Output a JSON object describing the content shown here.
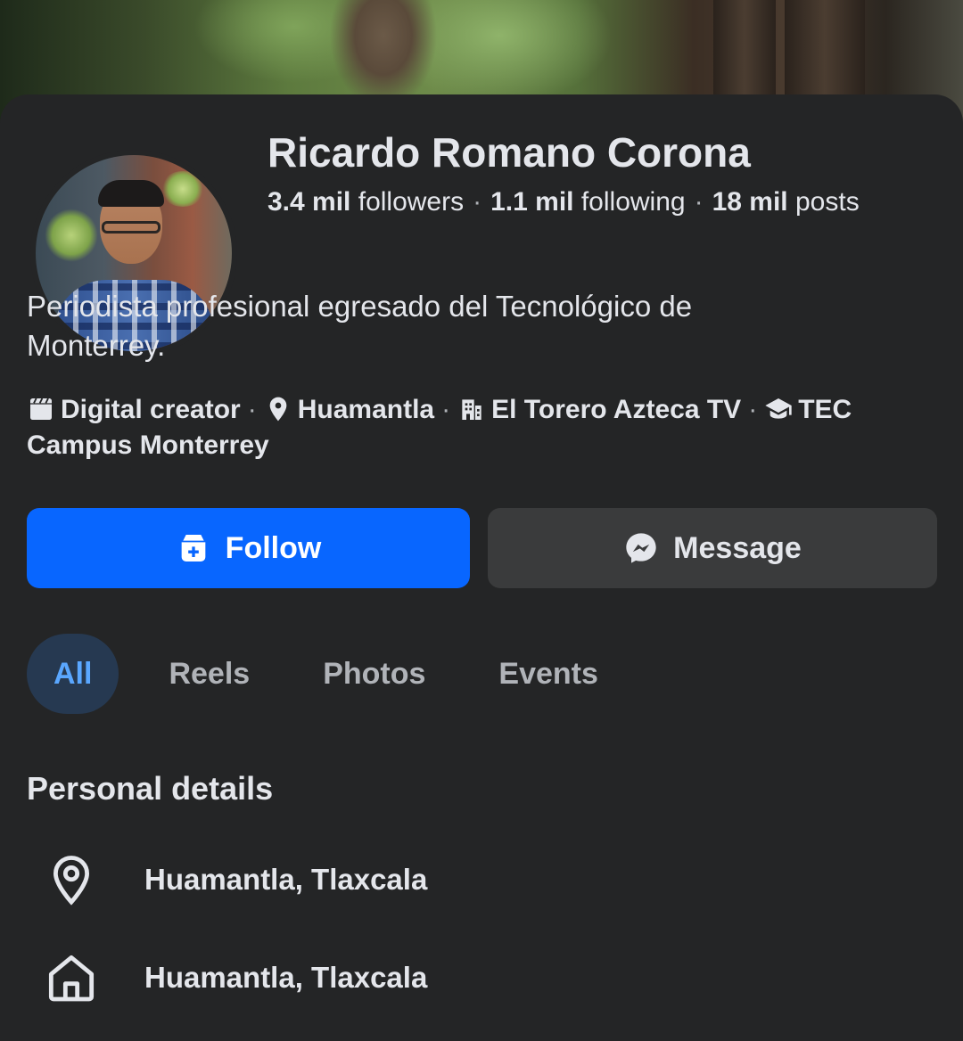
{
  "profile": {
    "name": "Ricardo Romano Corona",
    "followers_count": "3.4 mil",
    "followers_label": "followers",
    "following_count": "1.1 mil",
    "following_label": "following",
    "posts_count": "18 mil",
    "posts_label": "posts",
    "bio_line1": "Periodista profesional egresado del Tecnológico de",
    "bio_line2": "Monterrey."
  },
  "info_items": [
    {
      "icon": "clapperboard-icon",
      "label": "Digital creator"
    },
    {
      "icon": "location-pin-icon",
      "label": "Huamantla"
    },
    {
      "icon": "building-icon",
      "label": "El Torero Azteca TV"
    },
    {
      "icon": "graduation-cap-icon",
      "label": "TEC Campus Monterrey"
    }
  ],
  "actions": {
    "follow_label": "Follow",
    "follow_icon": "follow-add-icon",
    "message_label": "Message",
    "message_icon": "messenger-icon"
  },
  "tabs": [
    {
      "label": "All",
      "active": true
    },
    {
      "label": "Reels",
      "active": false
    },
    {
      "label": "Photos",
      "active": false
    },
    {
      "label": "Events",
      "active": false
    }
  ],
  "personal_details": {
    "title": "Personal details",
    "items": [
      {
        "icon": "location-pin-icon",
        "text": "Huamantla, Tlaxcala"
      },
      {
        "icon": "home-icon",
        "text": "Huamantla, Tlaxcala"
      }
    ]
  },
  "colors": {
    "background": "#242526",
    "primary_blue": "#0866ff",
    "secondary_button": "#3a3b3c",
    "active_tab_bg": "#263951",
    "active_tab_text": "#5aa7ff",
    "muted_text": "#b0b3b8",
    "text": "#e4e6eb"
  }
}
